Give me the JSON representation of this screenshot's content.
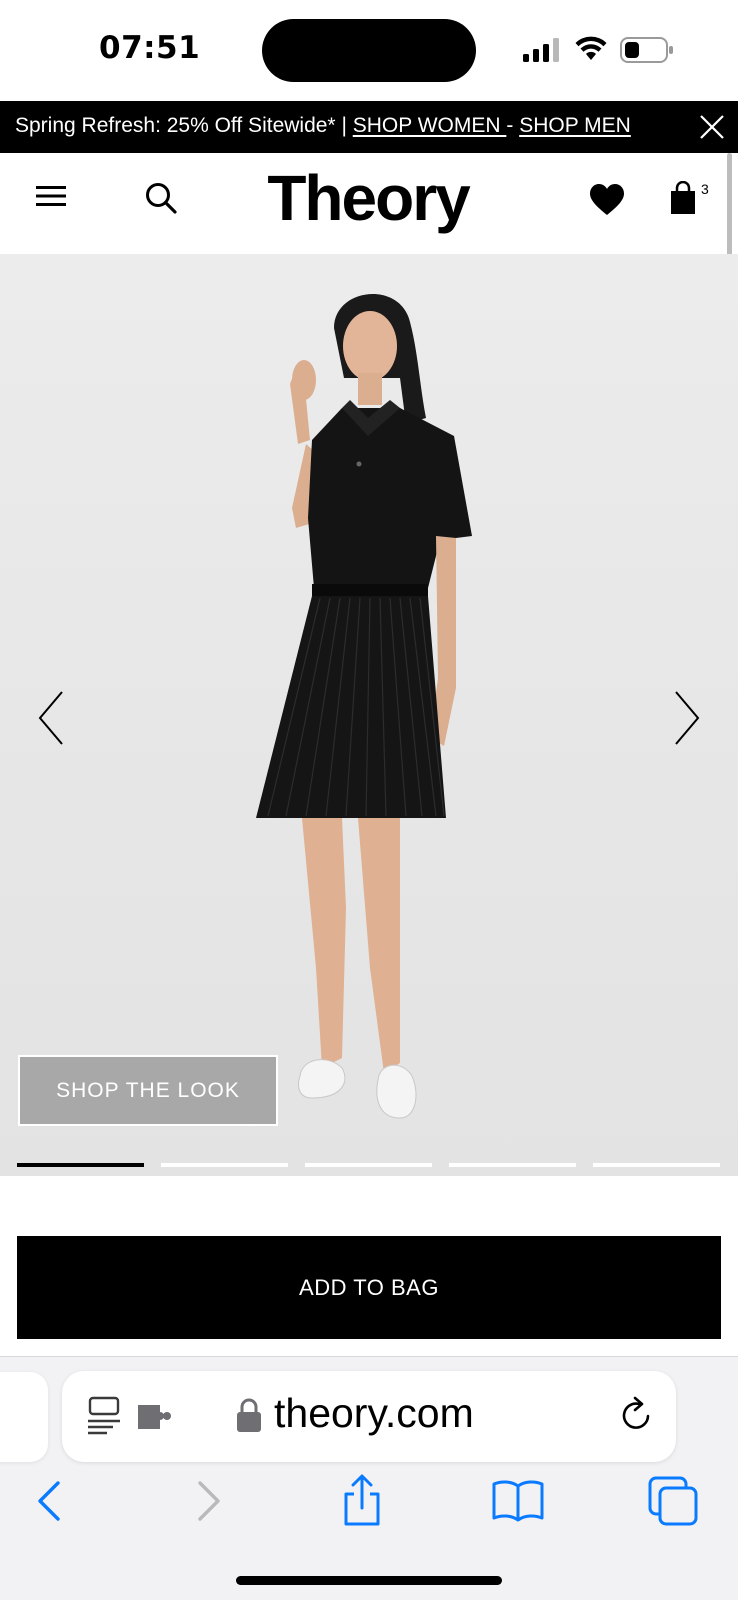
{
  "status_bar": {
    "time": "07:51",
    "icons": [
      "signal-icon",
      "wifi-icon",
      "battery-icon"
    ]
  },
  "promo_banner": {
    "text": "Spring Refresh: 25% Off Sitewide* | ",
    "link_women": "SHOP WOMEN ",
    "separator": "- ",
    "link_men": "SHOP MEN",
    "close_icon": "close-icon"
  },
  "header": {
    "logo": "Theory",
    "menu_icon": "hamburger-menu-icon",
    "search_icon": "search-icon",
    "wishlist_icon": "heart-icon",
    "bag_icon": "shopping-bag-icon",
    "bag_count": "3"
  },
  "hero": {
    "shop_the_look_label": "SHOP THE LOOK",
    "prev_icon": "chevron-left-icon",
    "next_icon": "chevron-right-icon",
    "pagination": {
      "total": 5,
      "active_index": 0
    }
  },
  "product": {
    "add_to_bag_label": "ADD TO BAG"
  },
  "browser": {
    "url": "theory.com",
    "icons": {
      "reader": "reader-mode-icon",
      "extension": "extension-icon",
      "lock": "lock-icon",
      "reload": "reload-icon",
      "back": "back-icon",
      "forward": "forward-icon",
      "share": "share-icon",
      "bookmarks": "bookmarks-icon",
      "tabs": "tabs-icon"
    }
  },
  "colors": {
    "primary": "#000000",
    "background": "#ffffff",
    "hero_background": "#e8e8e8",
    "safari_blue": "#0a7aff",
    "shop_look_fill": "#a8a8a8"
  }
}
